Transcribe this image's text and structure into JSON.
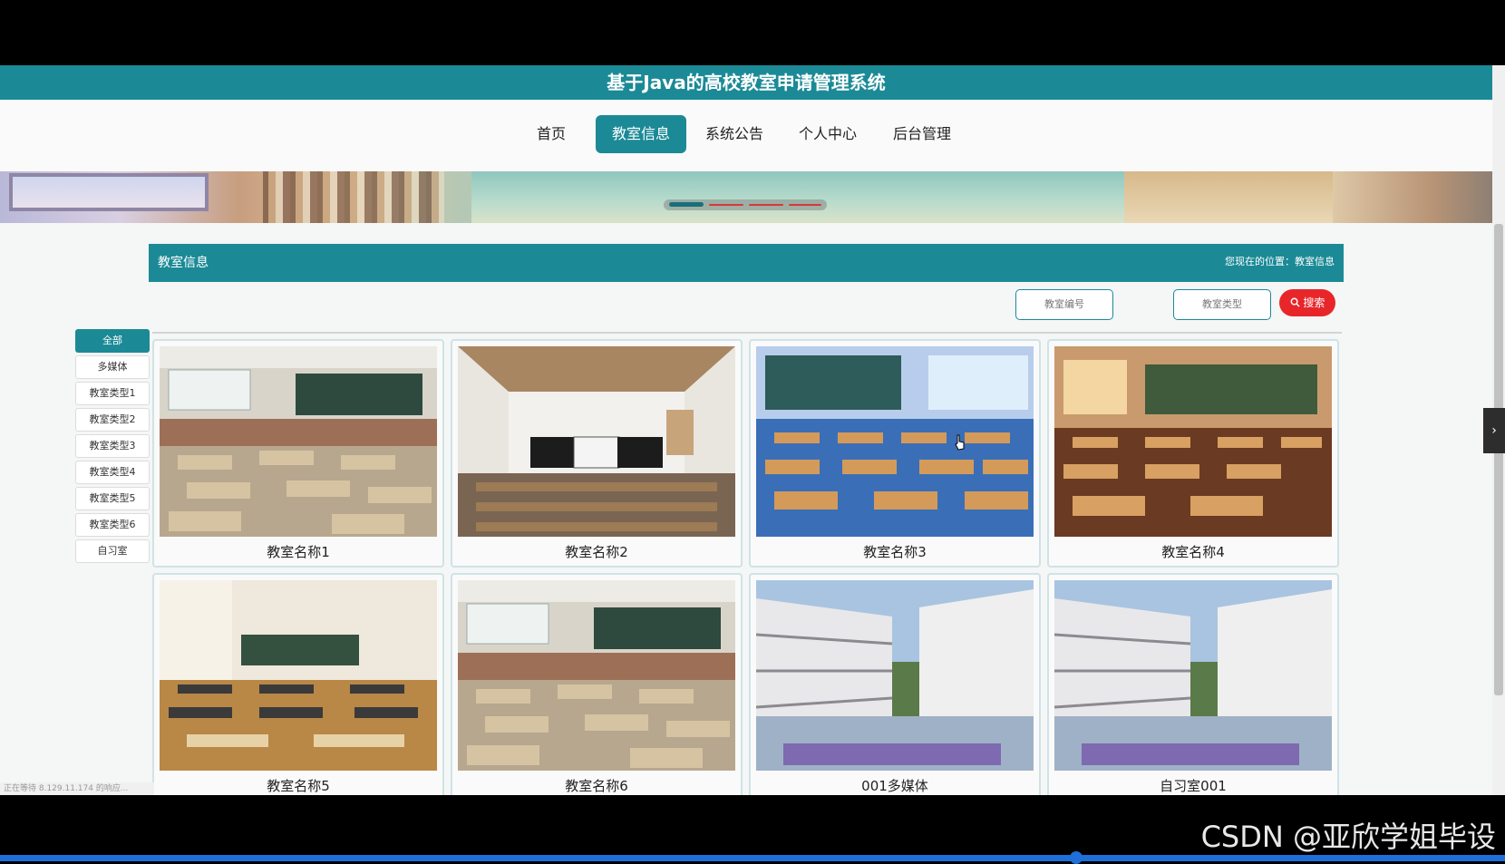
{
  "app": {
    "title": "基于Java的高校教室申请管理系统"
  },
  "nav": {
    "items": [
      "首页",
      "教室信息",
      "系统公告",
      "个人中心",
      "后台管理"
    ],
    "active_index": 1
  },
  "section": {
    "title": "教室信息",
    "breadcrumb": "您现在的位置：教室信息"
  },
  "search": {
    "room_number_placeholder": "教室编号",
    "room_type_placeholder": "教室类型",
    "button_label": "搜索"
  },
  "categories": [
    "全部",
    "多媒体",
    "教室类型1",
    "教室类型2",
    "教室类型3",
    "教室类型4",
    "教室类型5",
    "教室类型6",
    "自习室"
  ],
  "active_category_index": 0,
  "cards": [
    {
      "name": "教室名称1",
      "image": "classroom-photo"
    },
    {
      "name": "教室名称2",
      "image": "modern-classroom-photo"
    },
    {
      "name": "教室名称3",
      "image": "anime-classroom-blue"
    },
    {
      "name": "教室名称4",
      "image": "anime-classroom-sunset"
    },
    {
      "name": "教室名称5",
      "image": "classroom-photo-wood-floor"
    },
    {
      "name": "教室名称6",
      "image": "classroom-photo"
    },
    {
      "name": "001多媒体",
      "image": "school-building-courtyard"
    },
    {
      "name": "自习室001",
      "image": "school-building-courtyard"
    }
  ],
  "status": "正在等待 8.129.11.174 的响应...",
  "watermark": "CSDN @亚欣学姐毕设",
  "colors": {
    "primary": "#1b8a96",
    "search_button": "#e8262a"
  }
}
